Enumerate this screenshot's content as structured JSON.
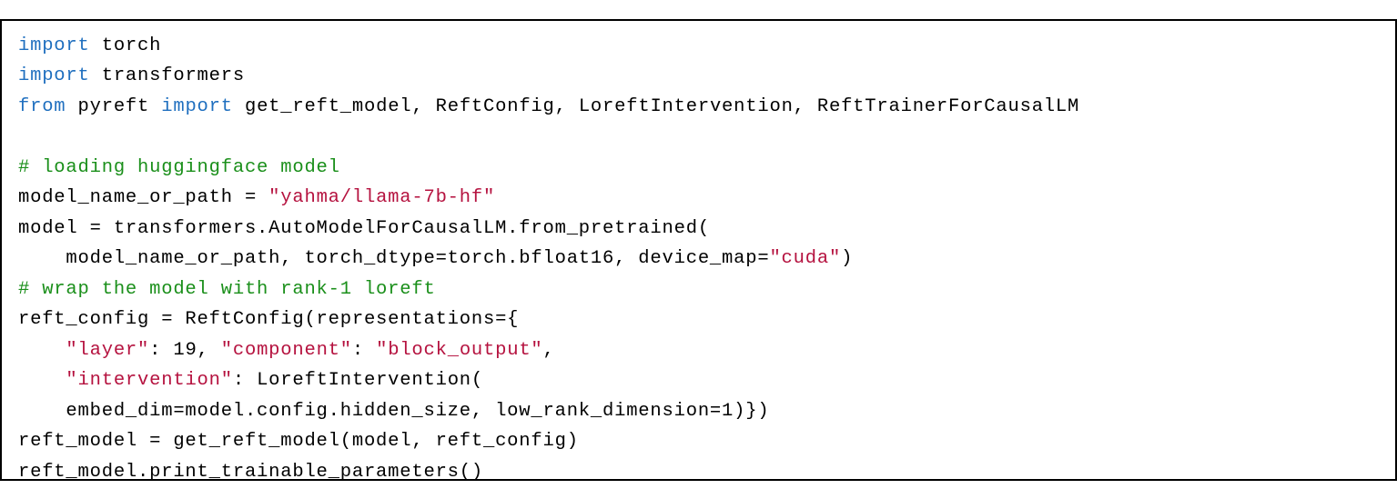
{
  "code": {
    "lines": [
      [
        {
          "cls": "tok-kw",
          "text": "import"
        },
        {
          "cls": "tok-pl",
          "text": " torch"
        }
      ],
      [
        {
          "cls": "tok-kw",
          "text": "import"
        },
        {
          "cls": "tok-pl",
          "text": " transformers"
        }
      ],
      [
        {
          "cls": "tok-kw",
          "text": "from"
        },
        {
          "cls": "tok-pl",
          "text": " pyreft "
        },
        {
          "cls": "tok-kw",
          "text": "import"
        },
        {
          "cls": "tok-pl",
          "text": " get_reft_model, ReftConfig, LoreftIntervention, ReftTrainerForCausalLM"
        }
      ],
      [
        {
          "cls": "tok-pl",
          "text": ""
        }
      ],
      [
        {
          "cls": "tok-cmt",
          "text": "# loading huggingface model"
        }
      ],
      [
        {
          "cls": "tok-pl",
          "text": "model_name_or_path = "
        },
        {
          "cls": "tok-str",
          "text": "\"yahma/llama-7b-hf\""
        }
      ],
      [
        {
          "cls": "tok-pl",
          "text": "model = transformers.AutoModelForCausalLM.from_pretrained("
        }
      ],
      [
        {
          "cls": "tok-pl",
          "text": "    model_name_or_path, torch_dtype=torch.bfloat16, device_map="
        },
        {
          "cls": "tok-str",
          "text": "\"cuda\""
        },
        {
          "cls": "tok-pl",
          "text": ")"
        }
      ],
      [
        {
          "cls": "tok-cmt",
          "text": "# wrap the model with rank-1 loreft"
        }
      ],
      [
        {
          "cls": "tok-pl",
          "text": "reft_config = ReftConfig(representations={"
        }
      ],
      [
        {
          "cls": "tok-pl",
          "text": "    "
        },
        {
          "cls": "tok-str",
          "text": "\"layer\""
        },
        {
          "cls": "tok-pl",
          "text": ": 19, "
        },
        {
          "cls": "tok-str",
          "text": "\"component\""
        },
        {
          "cls": "tok-pl",
          "text": ": "
        },
        {
          "cls": "tok-str",
          "text": "\"block_output\""
        },
        {
          "cls": "tok-pl",
          "text": ","
        }
      ],
      [
        {
          "cls": "tok-pl",
          "text": "    "
        },
        {
          "cls": "tok-str",
          "text": "\"intervention\""
        },
        {
          "cls": "tok-pl",
          "text": ": LoreftIntervention("
        }
      ],
      [
        {
          "cls": "tok-pl",
          "text": "    embed_dim=model.config.hidden_size, low_rank_dimension=1)})"
        }
      ],
      [
        {
          "cls": "tok-pl",
          "text": "reft_model = get_reft_model(model, reft_config)"
        }
      ],
      [
        {
          "cls": "tok-pl",
          "text": "reft_model.print_trainable_parameters()"
        }
      ]
    ]
  }
}
